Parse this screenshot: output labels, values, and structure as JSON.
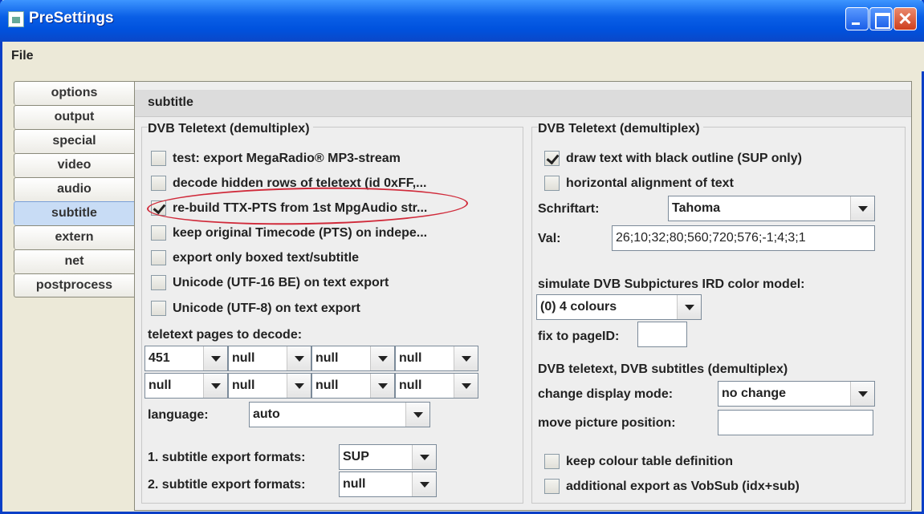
{
  "window": {
    "title": "PreSettings"
  },
  "menu": {
    "file": "File"
  },
  "tabs": [
    "options",
    "output",
    "special",
    "video",
    "audio",
    "subtitle",
    "extern",
    "net",
    "postprocess"
  ],
  "panel": {
    "title": "subtitle"
  },
  "left": {
    "section": "DVB Teletext (demultiplex)",
    "checks": [
      {
        "label": "test: export MegaRadio® MP3-stream",
        "checked": false
      },
      {
        "label": "decode hidden rows of teletext (id 0xFF,...",
        "checked": false
      },
      {
        "label": "re-build TTX-PTS from 1st MpgAudio str...",
        "checked": true
      },
      {
        "label": "keep original Timecode (PTS) on indepe...",
        "checked": false
      },
      {
        "label": "export only boxed text/subtitle",
        "checked": false
      },
      {
        "label": "Unicode (UTF-16 BE) on text export",
        "checked": false
      },
      {
        "label": "Unicode (UTF-8) on text export",
        "checked": false
      }
    ],
    "pages_label": "teletext pages to decode:",
    "pages": [
      [
        "451",
        "null",
        "null",
        "null"
      ],
      [
        "null",
        "null",
        "null",
        "null"
      ]
    ],
    "language_label": "language:",
    "language": "auto",
    "export1_label": "1. subtitle export formats:",
    "export1": "SUP",
    "export2_label": "2. subtitle export formats:",
    "export2": "null"
  },
  "right": {
    "section": "DVB Teletext (demultiplex)",
    "outline": {
      "label": "draw text with black outline (SUP only)",
      "checked": true
    },
    "halign": {
      "label": "horizontal alignment of text",
      "checked": false
    },
    "font_label": "Schriftart:",
    "font": "Tahoma",
    "val_label": "Val:",
    "val": "26;10;32;80;560;720;576;-1;4;3;1",
    "irdc_label": "simulate DVB Subpictures IRD color model:",
    "irdc": "(0) 4 colours",
    "fixpage_label": "fix to pageID:",
    "fixpage": "",
    "sub_section": "DVB teletext, DVB subtitles (demultiplex)",
    "display_label": "change display mode:",
    "display": "no change",
    "move_label": "move picture position:",
    "move": "",
    "keepcolour": {
      "label": "keep colour table definition",
      "checked": false
    },
    "vobsub": {
      "label": "additional export as VobSub (idx+sub)",
      "checked": false
    }
  },
  "colors": {
    "titlebar": "#0a5fe6",
    "highlight": "#d02a3a",
    "active_tab": "#c8dcf5"
  }
}
